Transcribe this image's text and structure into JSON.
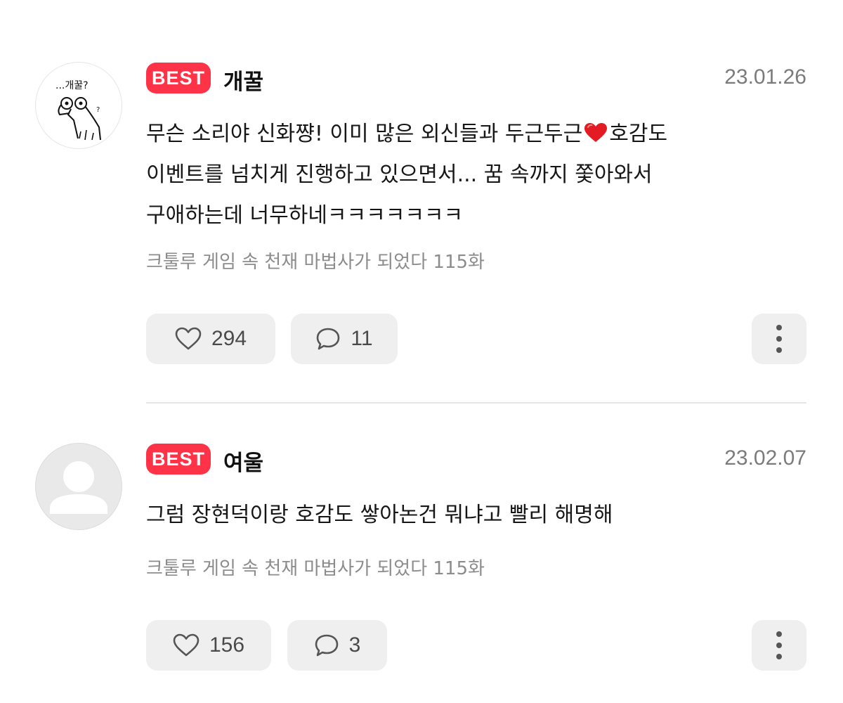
{
  "comments": [
    {
      "badge": "BEST",
      "author": "개꿀",
      "date": "23.01.26",
      "text_before_emoji": "무슨 소리야 신화쨩! 이미 많은 외신들과 두근두근",
      "text_after_emoji": "호감도\n이벤트를 넘치게 진행하고 있으면서... 꿈 속까지 쫓아와서\n구애하는데 너무하네ㅋㅋㅋㅋㅋㅋㅋ",
      "source": "크툴루 게임 속 천재 마법사가 되었다 115화",
      "likes": "294",
      "replies": "11",
      "avatar_text": "...개꿀?"
    },
    {
      "badge": "BEST",
      "author": "여울",
      "date": "23.02.07",
      "text": "그럼 장현덕이랑 호감도 쌓아논건 뭐냐고 빨리 해명해",
      "source": "크툴루 게임 속 천재 마법사가 되었다 115화",
      "likes": "156",
      "replies": "3"
    }
  ],
  "colors": {
    "badge": "#ff3347",
    "button_bg": "#efefef",
    "meta_text": "#8c8c8c",
    "date_text": "#7b7b7b"
  },
  "icons": {
    "like": "heart-outline-icon",
    "reply": "speech-bubble-icon",
    "more": "vertical-ellipsis-icon",
    "emoji": "red-heart-emoji"
  }
}
